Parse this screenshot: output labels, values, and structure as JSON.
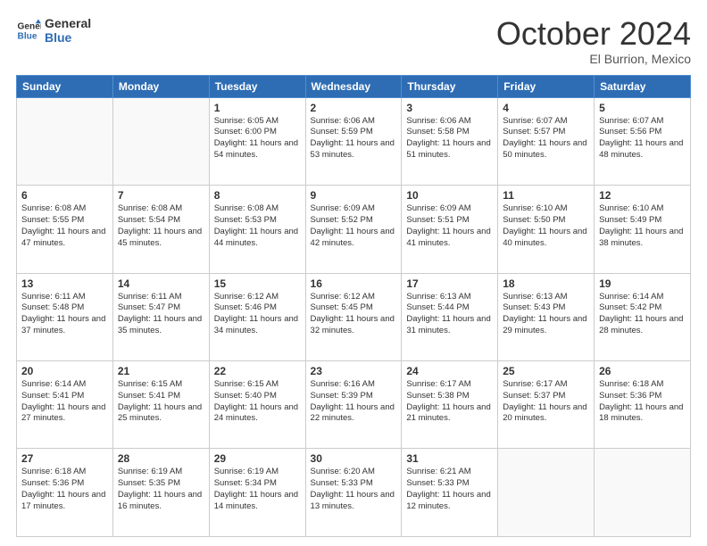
{
  "header": {
    "logo_line1": "General",
    "logo_line2": "Blue",
    "month": "October 2024",
    "location": "El Burrion, Mexico"
  },
  "weekdays": [
    "Sunday",
    "Monday",
    "Tuesday",
    "Wednesday",
    "Thursday",
    "Friday",
    "Saturday"
  ],
  "weeks": [
    [
      {
        "day": "",
        "text": ""
      },
      {
        "day": "",
        "text": ""
      },
      {
        "day": "1",
        "text": "Sunrise: 6:05 AM\nSunset: 6:00 PM\nDaylight: 11 hours and 54 minutes."
      },
      {
        "day": "2",
        "text": "Sunrise: 6:06 AM\nSunset: 5:59 PM\nDaylight: 11 hours and 53 minutes."
      },
      {
        "day": "3",
        "text": "Sunrise: 6:06 AM\nSunset: 5:58 PM\nDaylight: 11 hours and 51 minutes."
      },
      {
        "day": "4",
        "text": "Sunrise: 6:07 AM\nSunset: 5:57 PM\nDaylight: 11 hours and 50 minutes."
      },
      {
        "day": "5",
        "text": "Sunrise: 6:07 AM\nSunset: 5:56 PM\nDaylight: 11 hours and 48 minutes."
      }
    ],
    [
      {
        "day": "6",
        "text": "Sunrise: 6:08 AM\nSunset: 5:55 PM\nDaylight: 11 hours and 47 minutes."
      },
      {
        "day": "7",
        "text": "Sunrise: 6:08 AM\nSunset: 5:54 PM\nDaylight: 11 hours and 45 minutes."
      },
      {
        "day": "8",
        "text": "Sunrise: 6:08 AM\nSunset: 5:53 PM\nDaylight: 11 hours and 44 minutes."
      },
      {
        "day": "9",
        "text": "Sunrise: 6:09 AM\nSunset: 5:52 PM\nDaylight: 11 hours and 42 minutes."
      },
      {
        "day": "10",
        "text": "Sunrise: 6:09 AM\nSunset: 5:51 PM\nDaylight: 11 hours and 41 minutes."
      },
      {
        "day": "11",
        "text": "Sunrise: 6:10 AM\nSunset: 5:50 PM\nDaylight: 11 hours and 40 minutes."
      },
      {
        "day": "12",
        "text": "Sunrise: 6:10 AM\nSunset: 5:49 PM\nDaylight: 11 hours and 38 minutes."
      }
    ],
    [
      {
        "day": "13",
        "text": "Sunrise: 6:11 AM\nSunset: 5:48 PM\nDaylight: 11 hours and 37 minutes."
      },
      {
        "day": "14",
        "text": "Sunrise: 6:11 AM\nSunset: 5:47 PM\nDaylight: 11 hours and 35 minutes."
      },
      {
        "day": "15",
        "text": "Sunrise: 6:12 AM\nSunset: 5:46 PM\nDaylight: 11 hours and 34 minutes."
      },
      {
        "day": "16",
        "text": "Sunrise: 6:12 AM\nSunset: 5:45 PM\nDaylight: 11 hours and 32 minutes."
      },
      {
        "day": "17",
        "text": "Sunrise: 6:13 AM\nSunset: 5:44 PM\nDaylight: 11 hours and 31 minutes."
      },
      {
        "day": "18",
        "text": "Sunrise: 6:13 AM\nSunset: 5:43 PM\nDaylight: 11 hours and 29 minutes."
      },
      {
        "day": "19",
        "text": "Sunrise: 6:14 AM\nSunset: 5:42 PM\nDaylight: 11 hours and 28 minutes."
      }
    ],
    [
      {
        "day": "20",
        "text": "Sunrise: 6:14 AM\nSunset: 5:41 PM\nDaylight: 11 hours and 27 minutes."
      },
      {
        "day": "21",
        "text": "Sunrise: 6:15 AM\nSunset: 5:41 PM\nDaylight: 11 hours and 25 minutes."
      },
      {
        "day": "22",
        "text": "Sunrise: 6:15 AM\nSunset: 5:40 PM\nDaylight: 11 hours and 24 minutes."
      },
      {
        "day": "23",
        "text": "Sunrise: 6:16 AM\nSunset: 5:39 PM\nDaylight: 11 hours and 22 minutes."
      },
      {
        "day": "24",
        "text": "Sunrise: 6:17 AM\nSunset: 5:38 PM\nDaylight: 11 hours and 21 minutes."
      },
      {
        "day": "25",
        "text": "Sunrise: 6:17 AM\nSunset: 5:37 PM\nDaylight: 11 hours and 20 minutes."
      },
      {
        "day": "26",
        "text": "Sunrise: 6:18 AM\nSunset: 5:36 PM\nDaylight: 11 hours and 18 minutes."
      }
    ],
    [
      {
        "day": "27",
        "text": "Sunrise: 6:18 AM\nSunset: 5:36 PM\nDaylight: 11 hours and 17 minutes."
      },
      {
        "day": "28",
        "text": "Sunrise: 6:19 AM\nSunset: 5:35 PM\nDaylight: 11 hours and 16 minutes."
      },
      {
        "day": "29",
        "text": "Sunrise: 6:19 AM\nSunset: 5:34 PM\nDaylight: 11 hours and 14 minutes."
      },
      {
        "day": "30",
        "text": "Sunrise: 6:20 AM\nSunset: 5:33 PM\nDaylight: 11 hours and 13 minutes."
      },
      {
        "day": "31",
        "text": "Sunrise: 6:21 AM\nSunset: 5:33 PM\nDaylight: 11 hours and 12 minutes."
      },
      {
        "day": "",
        "text": ""
      },
      {
        "day": "",
        "text": ""
      }
    ]
  ]
}
